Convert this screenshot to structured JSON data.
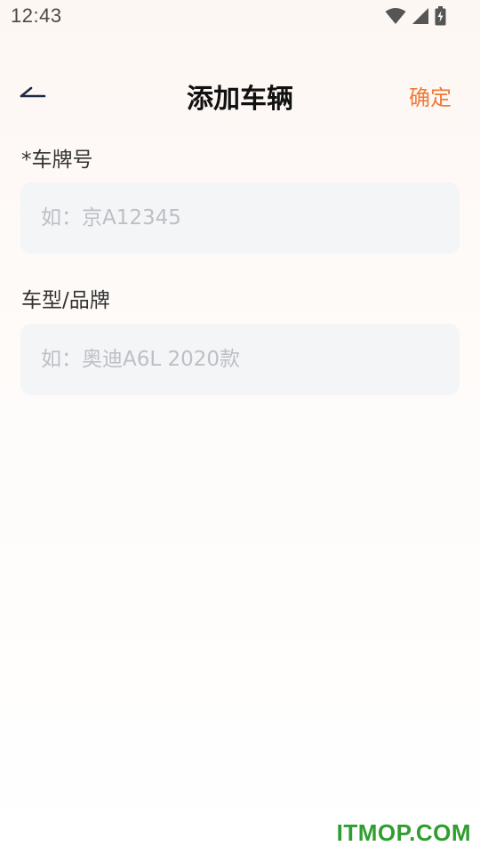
{
  "status_bar": {
    "time": "12:43",
    "icons": [
      "wifi-icon",
      "signal-icon",
      "battery-charging-icon"
    ]
  },
  "header": {
    "back_icon": "back-arrow-icon",
    "title": "添加车辆",
    "confirm_label": "确定"
  },
  "form": {
    "plate": {
      "label": "*车牌号",
      "value": "",
      "placeholder": "如：京A12345"
    },
    "model": {
      "label": "车型/品牌",
      "value": "",
      "placeholder": "如：奥迪A6L 2020款"
    }
  },
  "watermark": "ITMOP.COM",
  "colors": {
    "accent": "#f07a38",
    "input_bg": "#f4f5f7",
    "placeholder": "#bdbfc4",
    "watermark": "#2f9e2f"
  }
}
